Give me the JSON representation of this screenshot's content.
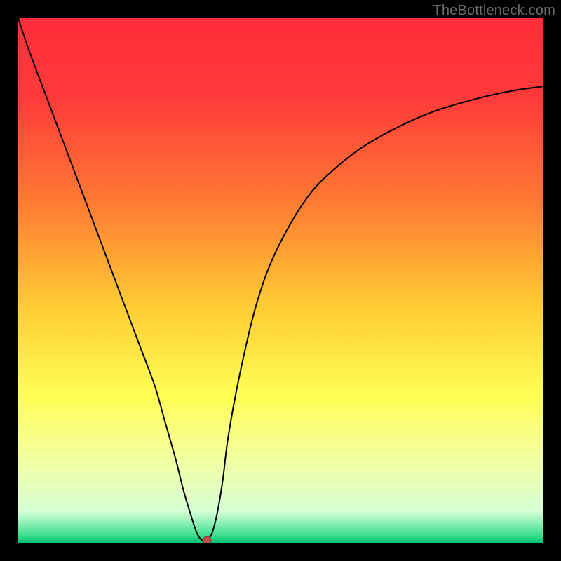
{
  "watermark": "TheBottleneck.com",
  "chart_data": {
    "type": "line",
    "title": "",
    "xlabel": "",
    "ylabel": "",
    "xlim": [
      0,
      100
    ],
    "ylim": [
      0,
      100
    ],
    "background_gradient": {
      "stops": [
        {
          "offset": 0.0,
          "color": "#ff2d3a"
        },
        {
          "offset": 0.15,
          "color": "#ff3a3a"
        },
        {
          "offset": 0.35,
          "color": "#ff7a33"
        },
        {
          "offset": 0.55,
          "color": "#ffcc33"
        },
        {
          "offset": 0.72,
          "color": "#ffff55"
        },
        {
          "offset": 0.84,
          "color": "#f3ffa0"
        },
        {
          "offset": 0.94,
          "color": "#d6ffd6"
        },
        {
          "offset": 0.985,
          "color": "#40e090"
        },
        {
          "offset": 1.0,
          "color": "#00c070"
        }
      ]
    },
    "series": [
      {
        "name": "curve",
        "color": "#000000",
        "stroke_width": 2,
        "x": [
          0,
          2,
          5,
          8,
          11,
          14,
          17,
          20,
          23,
          26,
          28,
          30,
          31.5,
          33,
          34,
          35,
          36,
          37,
          38,
          39,
          40,
          42,
          45,
          48,
          52,
          56,
          60,
          65,
          70,
          75,
          80,
          85,
          90,
          95,
          100
        ],
        "y": [
          100,
          94,
          86,
          78,
          70,
          62,
          54,
          46,
          38,
          30,
          23,
          16,
          10,
          5,
          2,
          0.5,
          0.5,
          2,
          6,
          12,
          20,
          31,
          44,
          53,
          61,
          67,
          71,
          75,
          78,
          80.5,
          82.5,
          84,
          85.3,
          86.3,
          87
        ]
      }
    ],
    "marker": {
      "name": "optimum-point",
      "x": 36,
      "y": 0.5,
      "rx": 6,
      "ry": 5,
      "fill": "#c05048",
      "stroke": "#8a3a34"
    }
  }
}
